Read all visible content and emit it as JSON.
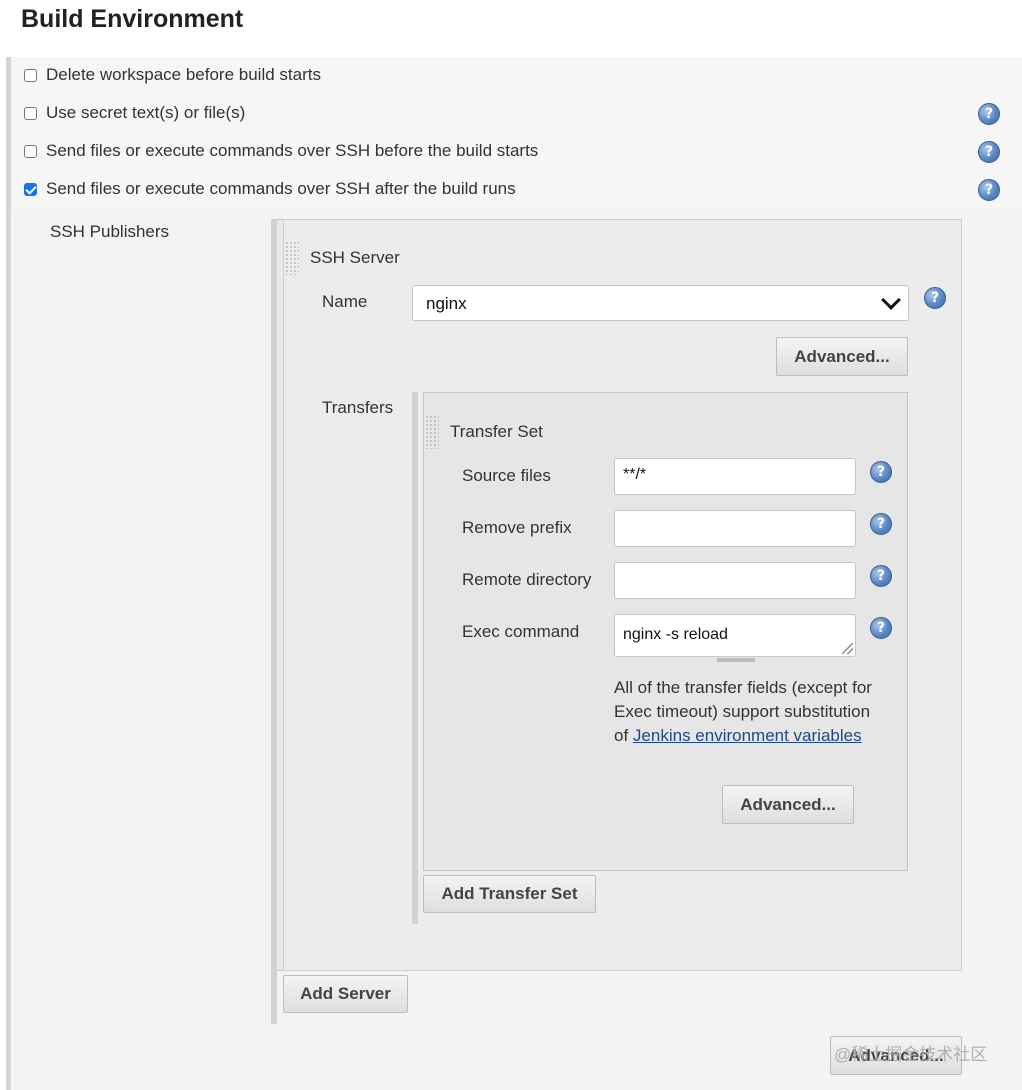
{
  "section": {
    "title": "Build Environment"
  },
  "options": [
    {
      "label": "Delete workspace before build starts",
      "checked": false,
      "help": false
    },
    {
      "label": "Use secret text(s) or file(s)",
      "checked": false,
      "help": true
    },
    {
      "label": "Send files or execute commands over SSH before the build starts",
      "checked": false,
      "help": true
    },
    {
      "label": "Send files or execute commands over SSH after the build runs",
      "checked": true,
      "help": true
    }
  ],
  "ssh_publishers": {
    "label": "SSH Publishers",
    "server": {
      "title": "SSH Server",
      "name_label": "Name",
      "name_value": "nginx",
      "advanced_label": "Advanced...",
      "transfers_label": "Transfers",
      "transfer_set": {
        "title": "Transfer Set",
        "source_files_label": "Source files",
        "source_files_value": "**/*",
        "remove_prefix_label": "Remove prefix",
        "remove_prefix_value": "",
        "remote_directory_label": "Remote directory",
        "remote_directory_value": "",
        "exec_command_label": "Exec command",
        "exec_command_value": "nginx -s reload",
        "note_text": "All of the transfer fields (except for Exec timeout) support substitution of",
        "note_link": "Jenkins environment variables",
        "advanced_label": "Advanced..."
      },
      "add_transfer_set_label": "Add Transfer Set"
    },
    "add_server_label": "Add Server",
    "advanced_label": "Advanced..."
  },
  "help_glyph": "?",
  "icons": {
    "help": "help-icon",
    "chevron": "chevron-down-icon",
    "checkbox": "checkbox"
  },
  "colors": {
    "link": "#204a87",
    "checkbox_checked": "#1a73e8",
    "help_icon": "#5a86c4"
  },
  "watermark": "@稀土掘金技术社区"
}
